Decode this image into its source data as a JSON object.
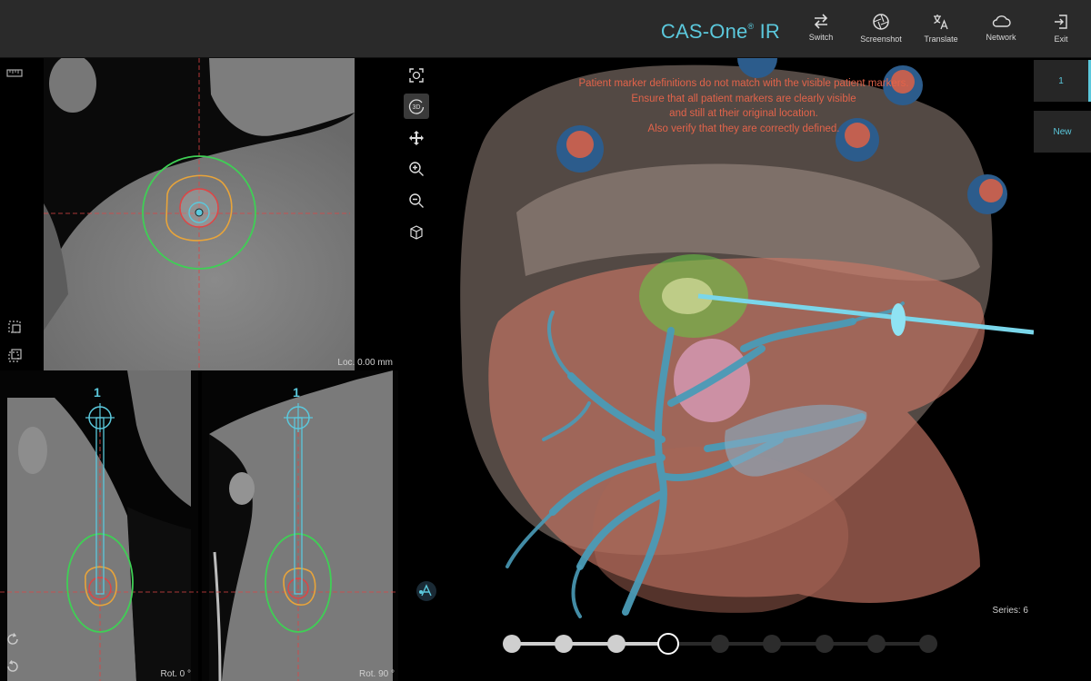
{
  "header": {
    "brand": "CAS-One",
    "brand_mark": "®",
    "brand_suffix": " IR",
    "buttons": [
      {
        "label": "Switch",
        "icon": "switch-icon"
      },
      {
        "label": "Screenshot",
        "icon": "aperture-icon"
      },
      {
        "label": "Translate",
        "icon": "translate-icon"
      },
      {
        "label": "Network",
        "icon": "cloud-icon"
      },
      {
        "label": "Exit",
        "icon": "exit-icon"
      }
    ]
  },
  "axial_view": {
    "loc_label": "Loc. 0.00 mm"
  },
  "sagittal_view": {
    "trajectory_number": "1",
    "rot_label": "Rot. 0 °"
  },
  "coronal_view": {
    "trajectory_number": "1",
    "rot_label": "Rot. 90 °"
  },
  "view3d": {
    "warning_lines": [
      "Patient marker definitions do not match with the visible patient markers.",
      "Ensure that all patient markers are clearly visible",
      "and still at their original location.",
      "Also verify that they are correctly defined."
    ],
    "tools": [
      "reset-view-icon",
      "3d-rotate-icon",
      "pan-icon",
      "zoom-in-icon",
      "zoom-out-icon",
      "orientation-cube-icon"
    ],
    "series_label": "Series: 6"
  },
  "trajectory_tabs": [
    {
      "label": "1",
      "active": true
    },
    {
      "label": "New",
      "active": false
    }
  ],
  "workflow": {
    "total_steps": 9,
    "current_step": 4
  },
  "colors": {
    "accent": "#5bc8dc",
    "warning": "#e2634a",
    "header_bg": "#2a2a2a"
  }
}
